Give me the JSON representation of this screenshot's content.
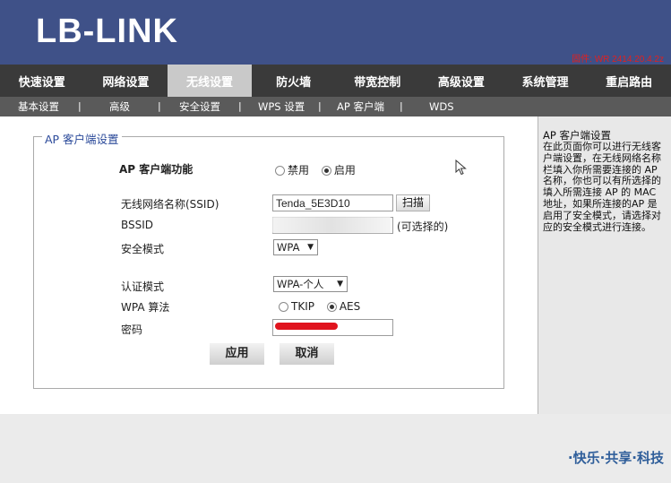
{
  "header": {
    "logo": "LB-LINK",
    "version": "固件: WR 2414.20.4.2z"
  },
  "main_nav": [
    "快速设置",
    "网络设置",
    "无线设置",
    "防火墙",
    "带宽控制",
    "高级设置",
    "系统管理",
    "重启路由"
  ],
  "main_nav_active": "无线设置",
  "sub_nav": [
    "基本设置",
    "高级",
    "安全设置",
    "WPS 设置",
    "AP 客户端",
    "WDS"
  ],
  "sub_nav_sep": "|",
  "form": {
    "legend": "AP 客户端设置",
    "ap_function_label": "AP 客户端功能",
    "ap_function_options": [
      "禁用",
      "启用"
    ],
    "ap_function_selected": "启用",
    "ssid_label": "无线网络名称(SSID)",
    "ssid_value": "Tenda_5E3D10",
    "scan_button": "扫描",
    "bssid_label": "BSSID",
    "bssid_hint": "(可选择的)",
    "security_label": "安全模式",
    "security_value": "WPA",
    "auth_label": "认证模式",
    "auth_value": "WPA-个人",
    "algo_label": "WPA 算法",
    "algo_options": [
      "TKIP",
      "AES"
    ],
    "algo_selected": "AES",
    "password_label": "密码",
    "apply_button": "应用",
    "cancel_button": "取消"
  },
  "side_help": {
    "title": "AP 客户端设置",
    "text": "在此页面你可以进行无线客户端设置，在无线网络名称栏填入你所需要连接的 AP 名称，你也可以有所选择的填入所需连接 AP 的 MAC 地址，如果所连接的AP 是启用了安全模式，请选择对应的安全模式进行连接。"
  },
  "footer": {
    "slogan": "·快乐·共享·科技"
  },
  "colors": {
    "header_bg": "#3f5188",
    "nav_bg": "#3a3a3a",
    "nav_active_bg": "#c9c9c9",
    "subnav_bg": "#5a5a5a",
    "legend_color": "#2b4a9a",
    "slogan_color": "#2f5e9a",
    "redaction_color": "#e0141e"
  }
}
